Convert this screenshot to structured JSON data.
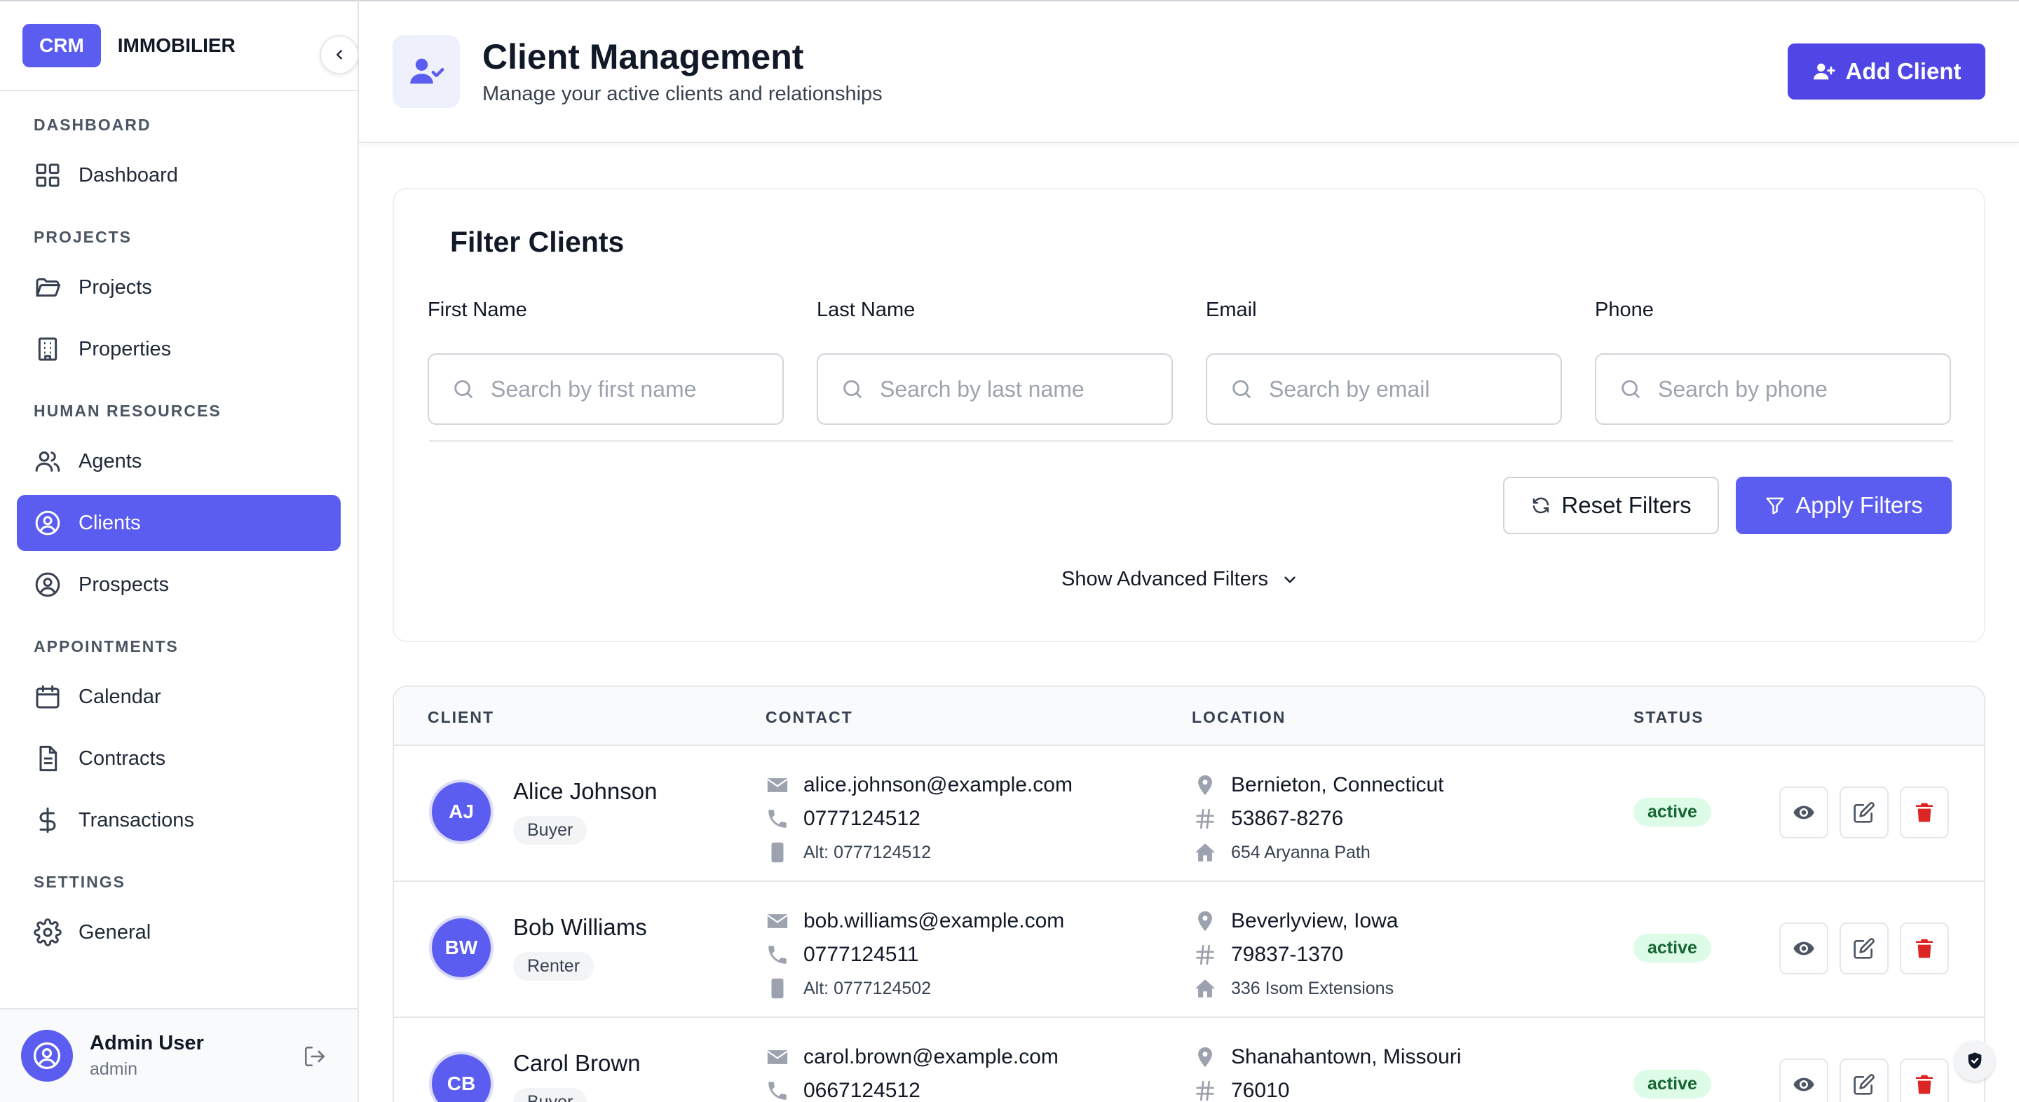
{
  "brand": {
    "badge": "CRM",
    "name": "IMMOBILIER"
  },
  "sidebar": {
    "sections": [
      {
        "title": "DASHBOARD",
        "items": [
          {
            "label": "Dashboard",
            "icon": "grid-icon"
          }
        ]
      },
      {
        "title": "PROJECTS",
        "items": [
          {
            "label": "Projects",
            "icon": "folder-icon"
          },
          {
            "label": "Properties",
            "icon": "building-icon"
          }
        ]
      },
      {
        "title": "HUMAN RESOURCES",
        "items": [
          {
            "label": "Agents",
            "icon": "users-icon"
          },
          {
            "label": "Clients",
            "icon": "user-circle-icon",
            "active": true
          },
          {
            "label": "Prospects",
            "icon": "user-circle-icon"
          }
        ]
      },
      {
        "title": "APPOINTMENTS",
        "items": [
          {
            "label": "Calendar",
            "icon": "calendar-icon"
          },
          {
            "label": "Contracts",
            "icon": "document-icon"
          },
          {
            "label": "Transactions",
            "icon": "dollar-icon"
          }
        ]
      },
      {
        "title": "SETTINGS",
        "items": [
          {
            "label": "General",
            "icon": "gear-icon"
          }
        ]
      }
    ],
    "user": {
      "name": "Admin User",
      "role": "admin"
    }
  },
  "header": {
    "title": "Client Management",
    "subtitle": "Manage your active clients and relationships",
    "add_label": "Add Client"
  },
  "filters": {
    "title": "Filter Clients",
    "fields": [
      {
        "label": "First Name",
        "placeholder": "Search by first name"
      },
      {
        "label": "Last Name",
        "placeholder": "Search by last name"
      },
      {
        "label": "Email",
        "placeholder": "Search by email"
      },
      {
        "label": "Phone",
        "placeholder": "Search by phone"
      }
    ],
    "reset_label": "Reset Filters",
    "apply_label": "Apply Filters",
    "advanced_label": "Show Advanced Filters"
  },
  "table": {
    "columns": [
      "CLIENT",
      "CONTACT",
      "LOCATION",
      "STATUS"
    ],
    "rows": [
      {
        "initials": "AJ",
        "name": "Alice Johnson",
        "type": "Buyer",
        "email": "alice.johnson@example.com",
        "phone": "0777124512",
        "alt": "Alt: 0777124512",
        "city": "Bernieton, Connecticut",
        "zip": "53867-8276",
        "address": "654 Aryanna Path",
        "status": "active"
      },
      {
        "initials": "BW",
        "name": "Bob Williams",
        "type": "Renter",
        "email": "bob.williams@example.com",
        "phone": "0777124511",
        "alt": "Alt: 0777124502",
        "city": "Beverlyview, Iowa",
        "zip": "79837-1370",
        "address": "336 Isom Extensions",
        "status": "active"
      },
      {
        "initials": "CB",
        "name": "Carol Brown",
        "type": "Buyer",
        "email": "carol.brown@example.com",
        "phone": "0667124512",
        "alt": "",
        "city": "Shanahantown, Missouri",
        "zip": "76010",
        "address": "",
        "status": "active"
      }
    ]
  },
  "colors": {
    "accent": "#5b5cf0",
    "accent_dark": "#4f46e5",
    "status_bg": "#dcfce7",
    "status_text": "#166534",
    "delete": "#dc2626"
  }
}
